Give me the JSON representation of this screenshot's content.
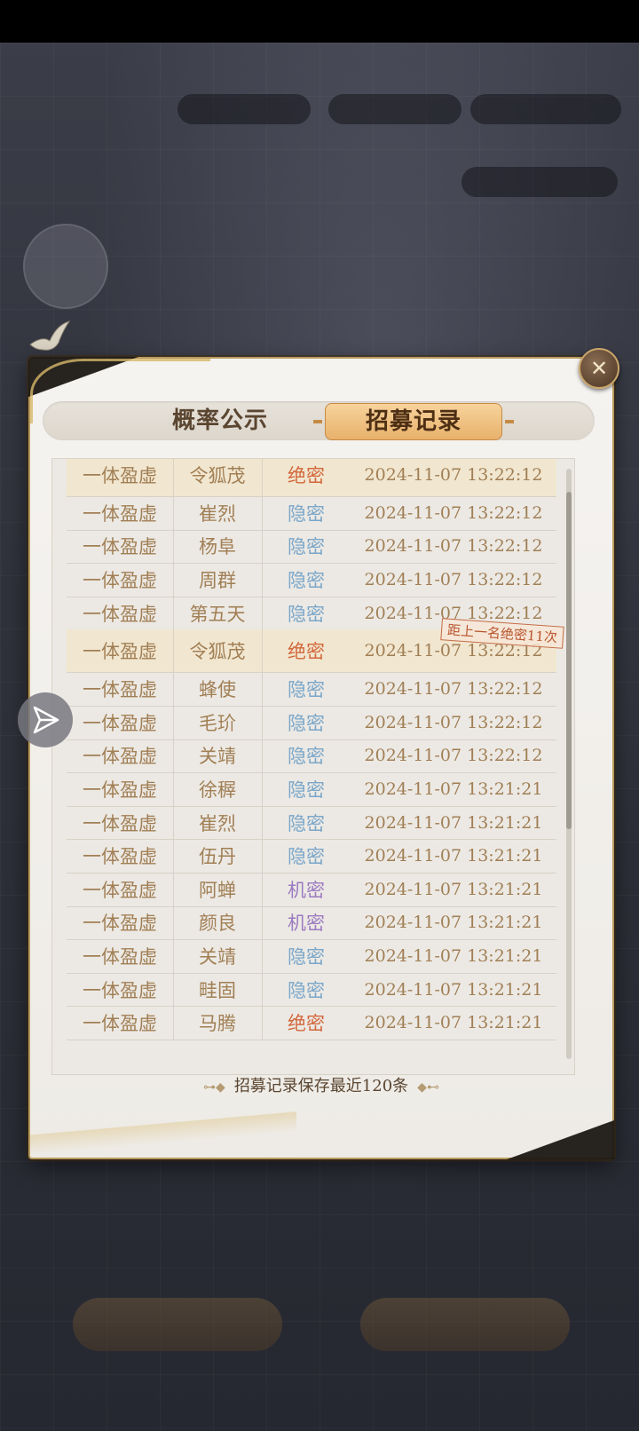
{
  "tabs": {
    "probability": "概率公示",
    "record": "招募记录"
  },
  "records": [
    {
      "pool": "一体盈虚",
      "name": "令狐茂",
      "rarity": "绝密",
      "rarity_class": "rar-jue",
      "time": "2024-11-07 13:22:12",
      "highlight": true,
      "stamp": ""
    },
    {
      "pool": "一体盈虚",
      "name": "崔烈",
      "rarity": "隐密",
      "rarity_class": "rar-yin",
      "time": "2024-11-07 13:22:12",
      "highlight": false,
      "stamp": ""
    },
    {
      "pool": "一体盈虚",
      "name": "杨阜",
      "rarity": "隐密",
      "rarity_class": "rar-yin",
      "time": "2024-11-07 13:22:12",
      "highlight": false,
      "stamp": ""
    },
    {
      "pool": "一体盈虚",
      "name": "周群",
      "rarity": "隐密",
      "rarity_class": "rar-yin",
      "time": "2024-11-07 13:22:12",
      "highlight": false,
      "stamp": ""
    },
    {
      "pool": "一体盈虚",
      "name": "第五天",
      "rarity": "隐密",
      "rarity_class": "rar-yin",
      "time": "2024-11-07 13:22:12",
      "highlight": false,
      "stamp": ""
    },
    {
      "pool": "一体盈虚",
      "name": "令狐茂",
      "rarity": "绝密",
      "rarity_class": "rar-jue",
      "time": "2024-11-07 13:22:12",
      "highlight": true,
      "stamp": "距上一名绝密11次"
    },
    {
      "pool": "一体盈虚",
      "name": "蜂使",
      "rarity": "隐密",
      "rarity_class": "rar-yin",
      "time": "2024-11-07 13:22:12",
      "highlight": false,
      "stamp": ""
    },
    {
      "pool": "一体盈虚",
      "name": "毛玠",
      "rarity": "隐密",
      "rarity_class": "rar-yin",
      "time": "2024-11-07 13:22:12",
      "highlight": false,
      "stamp": ""
    },
    {
      "pool": "一体盈虚",
      "name": "关靖",
      "rarity": "隐密",
      "rarity_class": "rar-yin",
      "time": "2024-11-07 13:22:12",
      "highlight": false,
      "stamp": ""
    },
    {
      "pool": "一体盈虚",
      "name": "徐稺",
      "rarity": "隐密",
      "rarity_class": "rar-yin",
      "time": "2024-11-07 13:21:21",
      "highlight": false,
      "stamp": ""
    },
    {
      "pool": "一体盈虚",
      "name": "崔烈",
      "rarity": "隐密",
      "rarity_class": "rar-yin",
      "time": "2024-11-07 13:21:21",
      "highlight": false,
      "stamp": ""
    },
    {
      "pool": "一体盈虚",
      "name": "伍丹",
      "rarity": "隐密",
      "rarity_class": "rar-yin",
      "time": "2024-11-07 13:21:21",
      "highlight": false,
      "stamp": ""
    },
    {
      "pool": "一体盈虚",
      "name": "阿蝉",
      "rarity": "机密",
      "rarity_class": "rar-ji",
      "time": "2024-11-07 13:21:21",
      "highlight": false,
      "stamp": ""
    },
    {
      "pool": "一体盈虚",
      "name": "颜良",
      "rarity": "机密",
      "rarity_class": "rar-ji",
      "time": "2024-11-07 13:21:21",
      "highlight": false,
      "stamp": ""
    },
    {
      "pool": "一体盈虚",
      "name": "关靖",
      "rarity": "隐密",
      "rarity_class": "rar-yin",
      "time": "2024-11-07 13:21:21",
      "highlight": false,
      "stamp": ""
    },
    {
      "pool": "一体盈虚",
      "name": "畦固",
      "rarity": "隐密",
      "rarity_class": "rar-yin",
      "time": "2024-11-07 13:21:21",
      "highlight": false,
      "stamp": ""
    },
    {
      "pool": "一体盈虚",
      "name": "马腾",
      "rarity": "绝密",
      "rarity_class": "rar-jue",
      "time": "2024-11-07 13:21:21",
      "highlight": false,
      "stamp": ""
    }
  ],
  "footer": {
    "note": "招募记录保存最近120条"
  },
  "icons": {
    "close": "close-icon",
    "float": "triangle-play-icon",
    "bird": "bird-icon"
  }
}
